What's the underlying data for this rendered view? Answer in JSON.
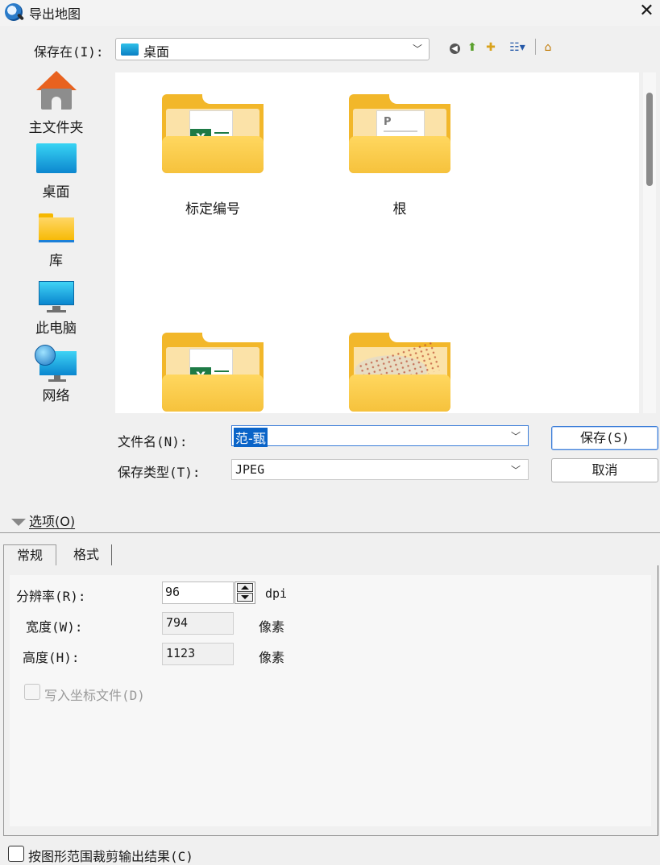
{
  "window": {
    "title": "导出地图",
    "close_label": "✕"
  },
  "save_in": {
    "label": "保存在(I):",
    "value": "桌面"
  },
  "toolbar": {
    "back_glyph": "◀",
    "up_glyph": "⬆",
    "newfolder_glyph": "✚",
    "views_glyph": "☷▾",
    "home_glyph": "⌂"
  },
  "places": [
    {
      "label": "主文件夹",
      "icon": "home-icon"
    },
    {
      "label": "桌面",
      "icon": "desktop-icon"
    },
    {
      "label": "库",
      "icon": "library-folder-icon"
    },
    {
      "label": "此电脑",
      "icon": "computer-icon"
    },
    {
      "label": "网络",
      "icon": "network-icon"
    }
  ],
  "files": [
    {
      "name": "标定编号",
      "icon": "excel-folder-icon"
    },
    {
      "name": "根",
      "icon": "document-folder-icon"
    },
    {
      "name": "",
      "icon": "excel-folder-icon"
    },
    {
      "name": "",
      "icon": "map-image-folder-icon"
    }
  ],
  "filename": {
    "label": "文件名(N):",
    "value": "范-甄"
  },
  "filetype": {
    "label": "保存类型(T):",
    "value": "JPEG"
  },
  "buttons": {
    "save": "保存(S)",
    "cancel": "取消"
  },
  "options": {
    "toggle_label": "选项(O)",
    "tabs": [
      "常规",
      "格式"
    ],
    "resolution": {
      "label": "分辨率(R):",
      "value": "96",
      "unit": "dpi"
    },
    "width": {
      "label": "宽度(W):",
      "value": "794",
      "unit": "像素"
    },
    "height": {
      "label": "高度(H):",
      "value": "1123",
      "unit": "像素"
    },
    "world_file": {
      "label": "写入坐标文件(D)",
      "checked": false,
      "enabled": false
    }
  },
  "clip": {
    "label": "按图形范围裁剪输出结果(C)",
    "checked": false
  },
  "colors": {
    "accent": "#0a64c8",
    "folder": "#f6c23c"
  }
}
